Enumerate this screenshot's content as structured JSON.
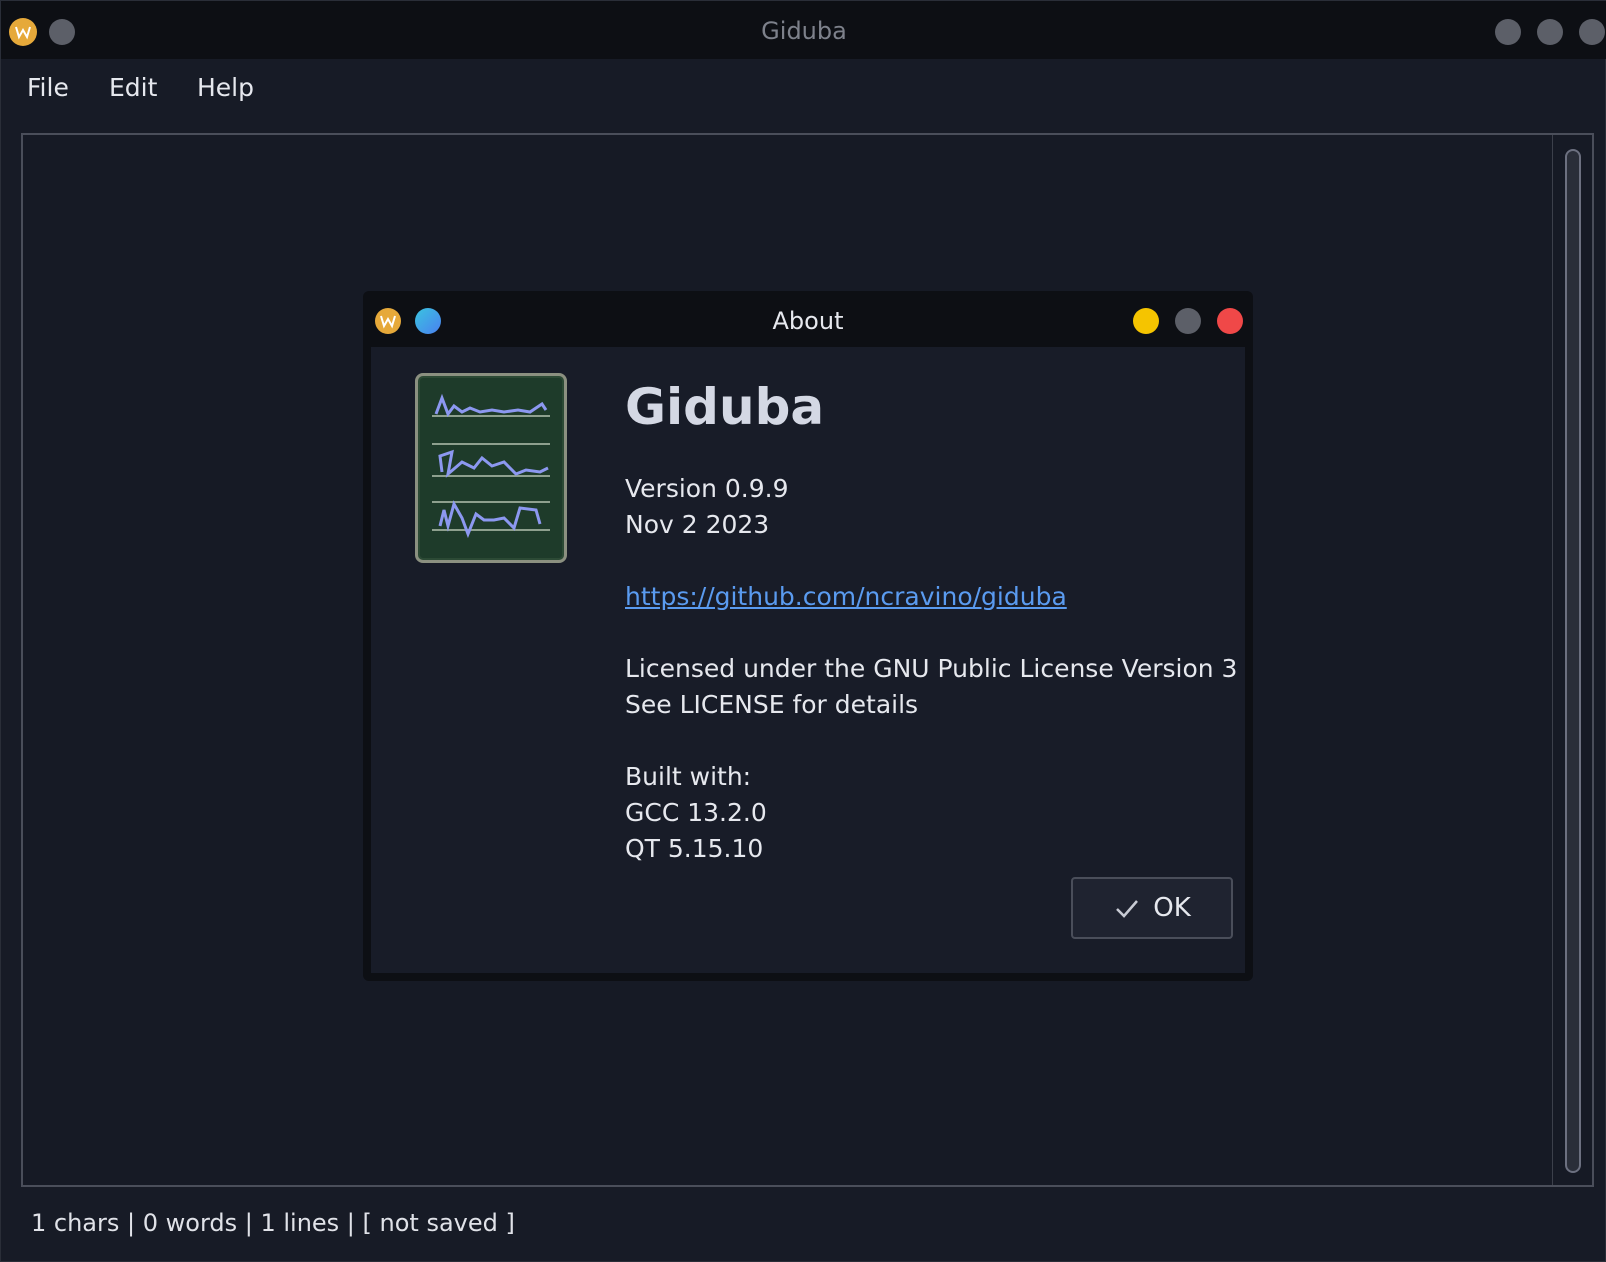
{
  "window": {
    "title": "Giduba"
  },
  "menu": {
    "file": "File",
    "edit": "Edit",
    "help": "Help"
  },
  "status": {
    "text": "1 chars | 0 words | 1 lines | [ not saved ]"
  },
  "dialog": {
    "title": "About",
    "app_name": "Giduba",
    "version": "Version 0.9.9",
    "date": "Nov 2 2023",
    "url": "https://github.com/ncravino/giduba",
    "license_line1": "Licensed under the GNU Public License Version 3",
    "license_line2": "See LICENSE for details",
    "built_with": "Built with:",
    "gcc": "GCC 13.2.0",
    "qt": "QT 5.15.10",
    "ok_label": "OK"
  },
  "colors": {
    "background": "#171b26",
    "titlebar": "#0d0f14",
    "link": "#5a9bf0",
    "minimize": "#f5c400",
    "close": "#f04848",
    "pin": "#3aa0e8",
    "logo": "#e6a93a"
  },
  "icons": {
    "app_logo": "kwin-w-logo-icon",
    "pin": "pin-icon",
    "ok": "checkmark-icon",
    "app_icon": "notepad-shorthand-icon"
  }
}
